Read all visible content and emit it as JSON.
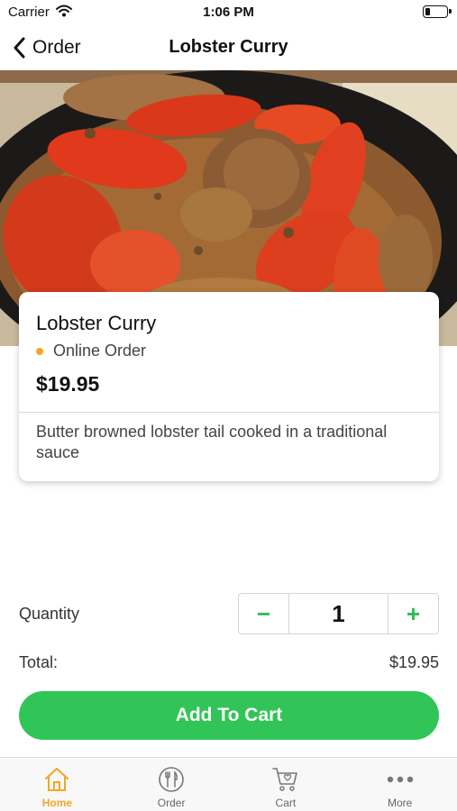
{
  "status_bar": {
    "carrier": "Carrier",
    "time": "1:06 PM"
  },
  "nav": {
    "back_label": "Order",
    "title": "Lobster Curry"
  },
  "product": {
    "name": "Lobster Curry",
    "status": "Online Order",
    "status_color": "#f5a623",
    "price": "$19.95",
    "description": "Butter browned lobster tail cooked in a traditional sauce"
  },
  "quantity": {
    "label": "Quantity",
    "value": "1",
    "minus": "−",
    "plus": "+"
  },
  "total": {
    "label": "Total:",
    "value": "$19.95"
  },
  "cart_button": {
    "label": "Add To Cart",
    "color": "#31c557"
  },
  "tab_bar": {
    "active_color": "#f5a623",
    "tabs": [
      {
        "label": "Home",
        "icon": "home-icon",
        "active": true
      },
      {
        "label": "Order",
        "icon": "plate-cutlery-icon",
        "active": false
      },
      {
        "label": "Cart",
        "icon": "cart-icon",
        "active": false
      },
      {
        "label": "More",
        "icon": "more-dots-icon",
        "active": false
      }
    ]
  }
}
